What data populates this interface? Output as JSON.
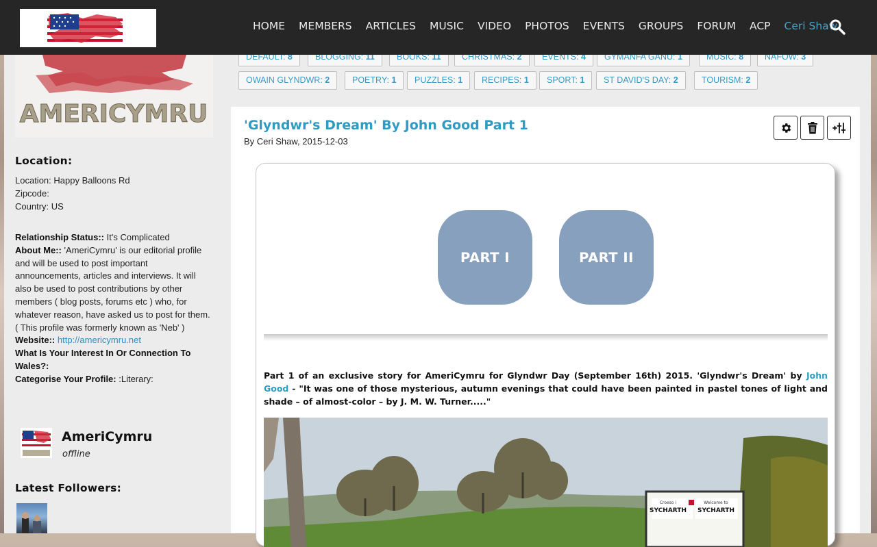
{
  "nav": {
    "items": [
      "HOME",
      "MEMBERS",
      "ARTICLES",
      "MUSIC",
      "VIDEO",
      "PHOTOS",
      "EVENTS",
      "GROUPS",
      "FORUM",
      "ACP"
    ],
    "user": "Ceri Shaw"
  },
  "tags": {
    "row1": [
      {
        "label": "DEFAULT:",
        "count": "8"
      },
      {
        "label": "BLOGGING:",
        "count": "11"
      },
      {
        "label": "BOOKS:",
        "count": "11"
      },
      {
        "label": "CHRISTMAS:",
        "count": "2"
      },
      {
        "label": "EVENTS:",
        "count": "4"
      },
      {
        "label": "GYMANFA GANU:",
        "count": "1"
      },
      {
        "label": "MUSIC:",
        "count": "8"
      },
      {
        "label": "NAFOW:",
        "count": "3"
      }
    ],
    "row2": [
      {
        "label": "OWAIN GLYNDWR:",
        "count": "2"
      },
      {
        "label": "POETRY:",
        "count": "1"
      },
      {
        "label": "PUZZLES:",
        "count": "1"
      },
      {
        "label": "RECIPES:",
        "count": "1"
      },
      {
        "label": "SPORT:",
        "count": "1"
      },
      {
        "label": "ST DAVID'S DAY:",
        "count": "2"
      },
      {
        "label": "TOURISM:",
        "count": "2"
      }
    ]
  },
  "sidebar": {
    "location_heading": "Location:",
    "location": "Location: Happy Balloons Rd",
    "zipcode": "Zipcode:",
    "country": "Country: US",
    "relationship_label": "Relationship Status::",
    "relationship_value": " It's Complicated",
    "about_label": "About Me::",
    "about_value": " 'AmeriCymru' is our editorial profile and will be used to post important announcements, articles and interviews. It will also be used to post contributions by other members ( blog posts, forums etc ) who, for whatever reason, have asked us to post for them. ( This profile was formerly known as 'Neb' )",
    "website_label": "Website::",
    "website_value": "http://americymru.net",
    "interest_label": "What Is Your Interest In Or Connection To Wales?:",
    "categorise_label": "Categorise Your Profile:",
    "categorise_value": " :Literary:",
    "member_name": "AmeriCymru",
    "member_status": "offline",
    "followers_heading": "Latest Followers:",
    "logo_text": "AMERICYMRU"
  },
  "article": {
    "title": "'Glyndwr's Dream' By John Good Part 1",
    "byline": "By Ceri Shaw, 2015-12-03",
    "part1": "PART I",
    "part2": "PART II",
    "intro_before": "Part 1 of an exclusive story for AmeriCymru for Glyndwr Day (September 16th) 2015. 'Glyndwr's Dream' by ",
    "intro_link": "John Good",
    "intro_after": " - \"It was one of those mysterious, autumn evenings that could have been painted in pastel tones of light and shade – of almost-color – by J. M. W. Turner.....\"",
    "sign_left_top": "Croeso i",
    "sign_left": "SYCHARTH",
    "sign_right_top": "Welcome to",
    "sign_right": "SYCHARTH"
  },
  "colors": {
    "navbar": "#262626",
    "link": "#2f9bc3",
    "part_button": "#87a0bd"
  }
}
